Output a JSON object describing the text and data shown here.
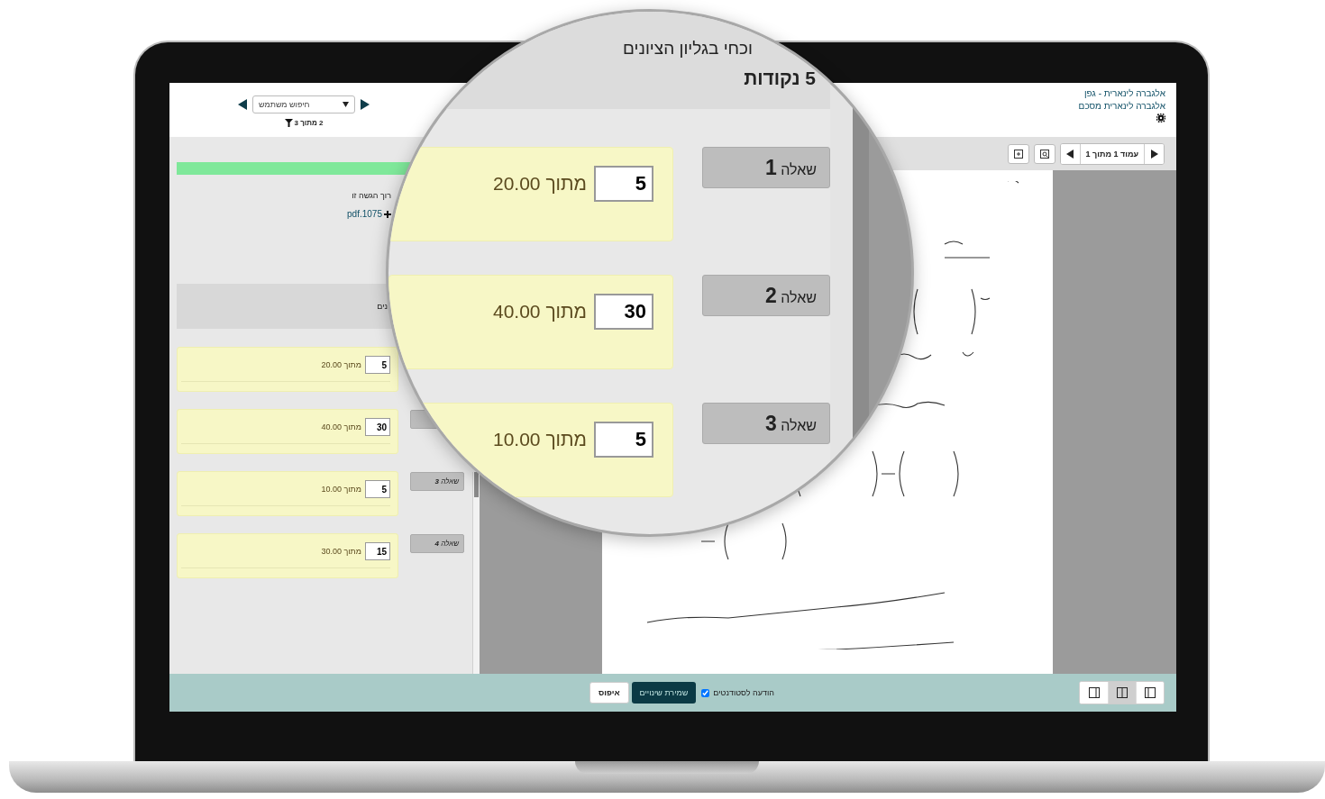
{
  "header": {
    "search": {
      "placeholder": "חיפוש משתמש"
    },
    "position": "2 מתוך 3",
    "course_links": [
      "אלגברה לינארית - גפן",
      "אלגברה לינארית מסכם"
    ]
  },
  "left_panel": {
    "progress": {
      "level": 1
    },
    "submission_note": "רוך הגשה זו",
    "file_link": "pdf.1075",
    "section_label": "נים",
    "questions": [
      {
        "kind": "hidden",
        "score": "5",
        "max": "מתוך 20.00"
      },
      {
        "kind": "blank",
        "score": "30",
        "max": "מתוך 40.00"
      },
      {
        "kind": "labeled",
        "label": "שאלה **3**",
        "score": "5",
        "max": "מתוך 10.00"
      },
      {
        "kind": "labeled",
        "label": "שאלה **4**",
        "score": "15",
        "max": "מתוך 30.00"
      }
    ]
  },
  "viewer": {
    "page_indicator": "עמוד 1 מתוך 1"
  },
  "bottom_bar": {
    "notify": {
      "label": "הודעה לסטודנטים",
      "checked": true
    },
    "save": "שמירת שינויים",
    "reset": "איפוס",
    "layouts": [
      {
        "selected": false
      },
      {
        "selected": true
      },
      {
        "selected": false
      }
    ]
  },
  "magnifier": {
    "title": "וכחי בגליון הציונים",
    "total": "5 נקודות",
    "questions": [
      {
        "label": "שאלה **1**",
        "score": "5",
        "max": "מתוך 20.00"
      },
      {
        "label": "שאלה **2**",
        "score": "30",
        "max": "מתוך 40.00"
      },
      {
        "label": "שאלה **3**",
        "score": "5",
        "max": "מתוך 10.00"
      }
    ]
  }
}
